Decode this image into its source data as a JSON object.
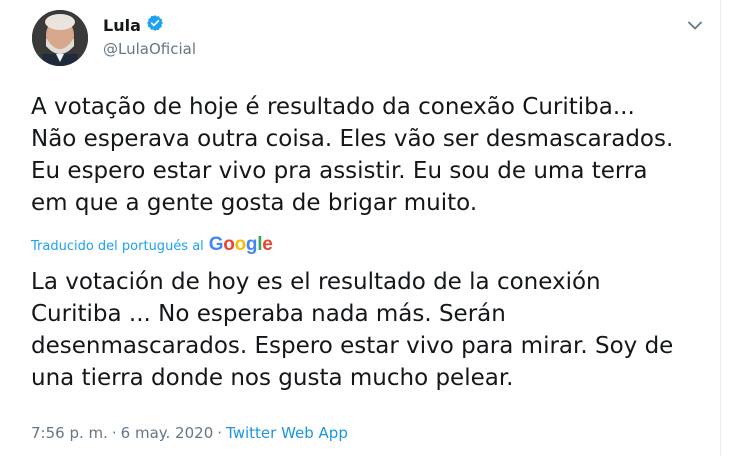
{
  "author": {
    "display_name": "Lula",
    "handle": "@LulaOficial",
    "verified": true
  },
  "tweet": {
    "text": "A votação de hoje é resultado da conexão Curitiba...\nNão esperava outra coisa. Eles vão ser desmascarados.\nEu espero estar vivo pra assistir. Eu sou de uma terra\nem que a gente gosta de brigar muito.",
    "translation_label": "Traducido del portugués al",
    "translation_provider": "Google",
    "translated_text": "La votación de hoy es el resultado de la conexión\nCuritiba ... No esperaba nada más. Serán\ndesenmascarados. Espero estar vivo para mirar. Soy de\nuna tierra donde nos gusta mucho pelear.",
    "time": "7:56 p. m.",
    "separator": "·",
    "date": "6 may. 2020",
    "source": "Twitter Web App"
  },
  "colors": {
    "verified_badge": "#1da1f2",
    "link": "#1da1f2",
    "muted": "#657786",
    "google_blue": "#4285f4",
    "google_red": "#ea4335",
    "google_yellow": "#fbbc05",
    "google_green": "#34a853"
  },
  "icons": {
    "verified": "verified-badge-icon",
    "more": "chevron-down-icon"
  }
}
